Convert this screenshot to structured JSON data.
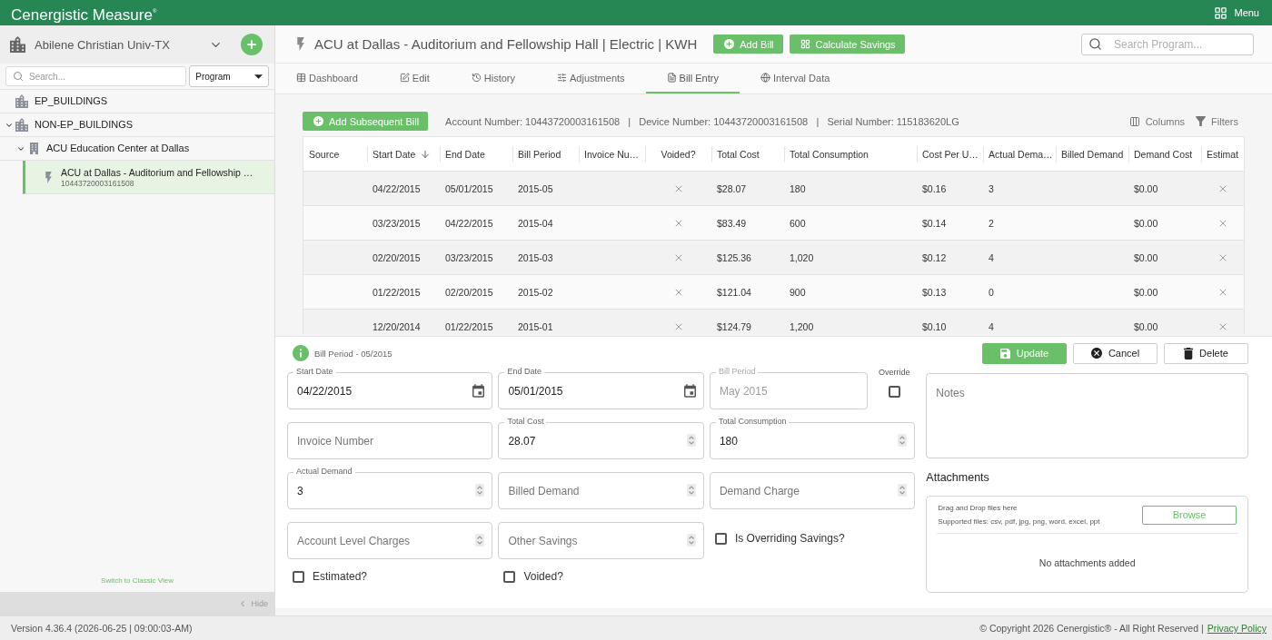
{
  "top_bar": {
    "logo": "Cenergistic Measure$^{®}$",
    "menu": "Menu"
  },
  "sidebar": {
    "organization": "Abilene Christian Univ-TX",
    "search": {
      "placeholder": "Search..."
    },
    "filter": "Program",
    "tree": [
      {
        "label": "EP_BUILDINGS",
        "kind": "group",
        "selected": false
      },
      {
        "label": "NON-EP_BUILDINGS",
        "kind": "group",
        "selected": false,
        "expanded": true,
        "children": [
          {
            "label": "ACU Education Center at Dallas",
            "kind": "building",
            "selected": false,
            "expanded": true,
            "children": [
              {
                "label": "ACU at Dallas - Auditorium and Fellowship …",
                "sublabel": "10443720003161508",
                "kind": "meter",
                "selected": true
              }
            ]
          }
        ]
      }
    ],
    "classic_view": "Switch to Classic View",
    "hide": "Hide"
  },
  "header": {
    "title": "ACU at Dallas - Auditorium and Fellowship Hall | Electric | KWH",
    "buttons": [
      {
        "label": "Add Bill",
        "kind": "add"
      },
      {
        "label": "Calculate Savings",
        "kind": "calculate"
      }
    ],
    "search": {
      "placeholder": "Search Program..."
    }
  },
  "tabs": [
    {
      "label": "Dashboard",
      "kind": "dashboard",
      "selected": false
    },
    {
      "label": "Edit",
      "kind": "edit",
      "selected": false
    },
    {
      "label": "History",
      "kind": "history",
      "selected": false
    },
    {
      "label": "Adjustments",
      "kind": "adjustments",
      "selected": false
    },
    {
      "label": "Bill Entry",
      "kind": "bill_entry",
      "selected": true
    },
    {
      "label": "Interval Data",
      "kind": "interval_data",
      "selected": false
    }
  ],
  "bill_entry": {
    "add_button": "Add Subsequent Bill",
    "meta": "Account Number: 10443720003161508   |   Device Number: 10443720003161508   |   Serial Number: 115183620LG",
    "tools": [
      {
        "label": "Columns",
        "kind": "columns"
      },
      {
        "label": "Filters",
        "kind": "filters"
      }
    ],
    "table": {
      "columns": [
        {
          "label": "Source",
          "kind": "text",
          "sorted": false
        },
        {
          "label": "Start Date",
          "kind": "text",
          "sorted": true
        },
        {
          "label": "End Date",
          "kind": "text",
          "sorted": false
        },
        {
          "label": "Bill Period",
          "kind": "text",
          "sorted": false
        },
        {
          "label": "Invoice Nu…",
          "kind": "text",
          "sorted": false
        },
        {
          "label": "Voided?",
          "kind": "flag",
          "sorted": false
        },
        {
          "label": "Total Cost",
          "kind": "text",
          "sorted": false
        },
        {
          "label": "Total Consumption",
          "kind": "text",
          "sorted": false
        },
        {
          "label": "Cost Per U…",
          "kind": "text",
          "sorted": false
        },
        {
          "label": "Actual Dema…",
          "kind": "text",
          "sorted": false
        },
        {
          "label": "Billed Demand",
          "kind": "text",
          "sorted": false
        },
        {
          "label": "Demand Cost",
          "kind": "text",
          "sorted": false
        },
        {
          "label": "Estimat",
          "kind": "flag",
          "sorted": false
        }
      ],
      "rows": [
        {
          "start_date": "04/22/2015",
          "end_date": "05/01/2015",
          "bill_period": "2015-05",
          "voided": false,
          "total_cost": "$28.07",
          "total_consumption": "180",
          "cost_per_unit": "$0.16",
          "actual_demand": "3",
          "demand_cost": "$0.00",
          "estimated": false
        },
        {
          "start_date": "03/23/2015",
          "end_date": "04/22/2015",
          "bill_period": "2015-04",
          "voided": false,
          "total_cost": "$83.49",
          "total_consumption": "600",
          "cost_per_unit": "$0.14",
          "actual_demand": "2",
          "demand_cost": "$0.00",
          "estimated": false
        },
        {
          "start_date": "02/20/2015",
          "end_date": "03/23/2015",
          "bill_period": "2015-03",
          "voided": false,
          "total_cost": "$125.36",
          "total_consumption": "1,020",
          "cost_per_unit": "$0.12",
          "actual_demand": "4",
          "demand_cost": "$0.00",
          "estimated": false
        },
        {
          "start_date": "01/22/2015",
          "end_date": "02/20/2015",
          "bill_period": "2015-02",
          "voided": false,
          "total_cost": "$121.04",
          "total_consumption": "900",
          "cost_per_unit": "$0.13",
          "actual_demand": "0",
          "demand_cost": "$0.00",
          "estimated": false
        },
        {
          "start_date": "12/20/2014",
          "end_date": "01/22/2015",
          "bill_period": "2015-01",
          "voided": false,
          "total_cost": "$124.79",
          "total_consumption": "1,200",
          "cost_per_unit": "$0.10",
          "actual_demand": "4",
          "demand_cost": "$0.00",
          "estimated": false
        }
      ]
    }
  },
  "edit_panel": {
    "title": "Bill Period - 05/2015",
    "actions": [
      {
        "label": "Update",
        "kind": "save"
      },
      {
        "label": "Cancel",
        "kind": "cancel"
      },
      {
        "label": "Delete",
        "kind": "delete"
      }
    ],
    "form": [
      [
        {
          "kind": "date",
          "label": "Start Date",
          "value": "04/22/2015",
          "disabled": false
        },
        {
          "kind": "date",
          "label": "End Date",
          "value": "05/01/2015",
          "disabled": false
        },
        {
          "kind": "text",
          "label": "Bill Period",
          "value": "May 2015",
          "disabled": true
        },
        {
          "kind": "checkbox_stacked",
          "label": "Override",
          "checked": false
        }
      ],
      [
        {
          "kind": "text",
          "placeholder": "Invoice Number",
          "disabled": false
        },
        {
          "kind": "number",
          "label": "Total Cost",
          "value": "28.07",
          "disabled": false
        },
        {
          "kind": "number",
          "label": "Total Consumption",
          "value": "180",
          "disabled": false
        }
      ],
      [
        {
          "kind": "number",
          "label": "Actual Demand",
          "value": "3",
          "disabled": false
        },
        {
          "kind": "number",
          "placeholder": "Billed Demand",
          "disabled": false
        },
        {
          "kind": "number",
          "placeholder": "Demand Charge",
          "disabled": false
        }
      ],
      [
        {
          "kind": "number",
          "placeholder": "Account Level Charges",
          "disabled": false
        },
        {
          "kind": "number",
          "placeholder": "Other Savings",
          "disabled": false
        },
        {
          "kind": "checkbox",
          "label": "Is Overriding Savings?",
          "checked": false
        }
      ],
      [
        {
          "kind": "checkbox",
          "label": "Estimated?",
          "checked": false
        },
        {
          "kind": "checkbox",
          "label": "Voided?",
          "checked": false
        }
      ]
    ],
    "notes": {
      "placeholder": "Notes"
    },
    "attachments": {
      "title": "Attachments",
      "hint": "Drag and Drop files here",
      "supported": "Supported files: csv, pdf, jpg, png, word, excel, ppt",
      "button": "Browse",
      "empty": "No attachments added"
    }
  },
  "footer": {
    "version": "Version 4.36.4 (2026-06-25 | 09:00:03-AM)",
    "copyright": "© Copyright 2026 Cenergistic® - All Right Reserved |",
    "privacy_link": "Privacy Policy"
  }
}
